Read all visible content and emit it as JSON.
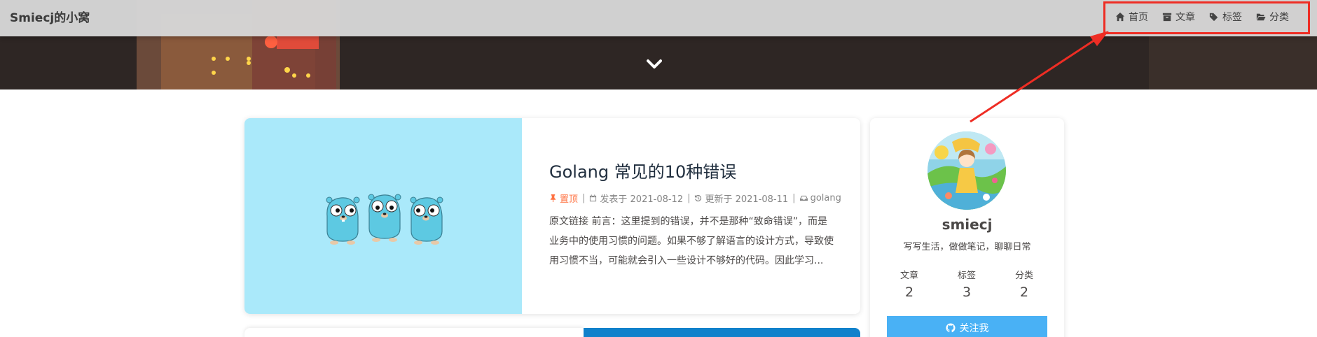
{
  "site": {
    "title": "Smiecj的小窝"
  },
  "nav": {
    "items": [
      {
        "label": "首页",
        "icon": "home-icon"
      },
      {
        "label": "文章",
        "icon": "archive-icon"
      },
      {
        "label": "标签",
        "icon": "tags-icon"
      },
      {
        "label": "分类",
        "icon": "folder-open-icon"
      }
    ]
  },
  "post": {
    "title": "Golang 常见的10种错误",
    "sticky_label": "置顶",
    "published_label": "发表于 2021-08-12",
    "updated_label": "更新于 2021-08-11",
    "category": "golang",
    "excerpt": "原文链接 前言：这里提到的错误，并不是那种“致命错误”，而是业务中的使用习惯的问题。如果不够了解语言的设计方式，导致使用习惯不当，可能就会引入一些设计不够好的代码。因此学习..."
  },
  "author": {
    "name": "smiecj",
    "description": "写写生活，做做笔记，聊聊日常",
    "stats": [
      {
        "label": "文章",
        "value": "2"
      },
      {
        "label": "标签",
        "value": "3"
      },
      {
        "label": "分类",
        "value": "2"
      }
    ],
    "follow_label": "关注我"
  },
  "colors": {
    "annotation": "#ee2d24",
    "accent": "#49b1f5",
    "sticky": "#ff7242",
    "cover_bg": "#aae9fa"
  }
}
